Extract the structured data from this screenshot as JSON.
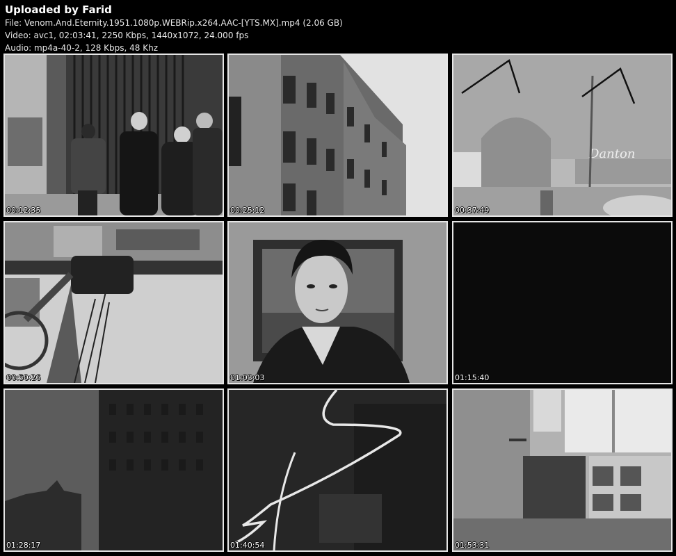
{
  "header": {
    "title": "Uploaded by Farid",
    "file_line": "File: Venom.And.Eternity.1951.1080p.WEBRip.x264.AAC-[YTS.MX].mp4 (2.06 GB)",
    "video_line": "Video: avc1, 02:03:41, 2250 Kbps, 1440x1072, 24.000 fps",
    "audio_line": "Audio: mp4a-40-2, 128 Kbps, 48 Khz"
  },
  "thumbnails": [
    {
      "timestamp": "00:12:35",
      "scene": "street-pedestrians"
    },
    {
      "timestamp": "00:25:12",
      "scene": "apartment-building"
    },
    {
      "timestamp": "00:37:49",
      "scene": "street-corner-danton"
    },
    {
      "timestamp": "00:50:26",
      "scene": "overturned-machinery"
    },
    {
      "timestamp": "01:03:03",
      "scene": "young-man-portrait"
    },
    {
      "timestamp": "01:15:40",
      "scene": "black-frame"
    },
    {
      "timestamp": "01:28:17",
      "scene": "dark-skyline"
    },
    {
      "timestamp": "01:40:54",
      "scene": "light-trail"
    },
    {
      "timestamp": "01:53:31",
      "scene": "room-interior"
    }
  ],
  "signage": {
    "shop_sign": "Danton"
  }
}
